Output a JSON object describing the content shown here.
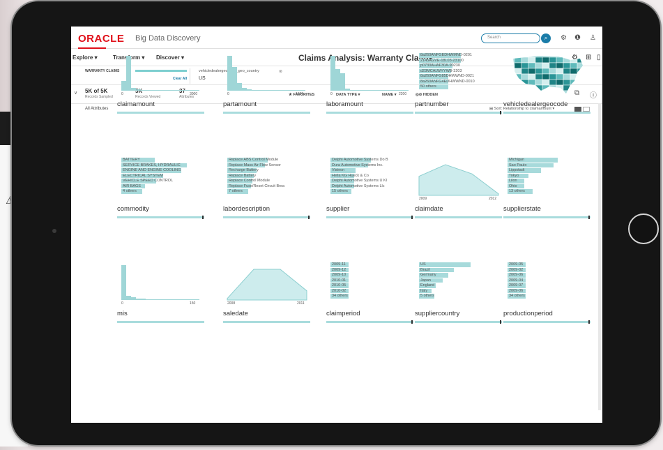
{
  "header": {
    "logo": "ORACLE",
    "product": "Big Data Discovery",
    "search_placeholder": "Search"
  },
  "nav": {
    "items": [
      "Explore ▾",
      "Transform ▾",
      "Discover ▾"
    ],
    "page_title": "Claims Analysis: Warranty Claims"
  },
  "refine": {
    "dataset": "WARRANTY CLAIMS",
    "clear_all": "Clear All",
    "facet_name": "vehicledealergeocode_geo_country",
    "facet_close": "⊗",
    "facet_value": "US"
  },
  "stats": {
    "sampled_value": "5K of 5K",
    "sampled_label": "Records Sampled",
    "viewed_value": "5K",
    "viewed_label": "Records Viewed",
    "attrs_value": "37",
    "attrs_label": "Attributes"
  },
  "toolbar": {
    "favorites": "★ FAVORITES",
    "data_type": "DATA TYPE ▾",
    "name": "NAME ▾",
    "hidden": "◎⊘ HIDDEN"
  },
  "sub": {
    "all_attributes": "All Attributes",
    "sort": "▤ Sort: Relationship to claimamount ▾"
  },
  "colors": {
    "bar": "#9fd6d7",
    "accent": "#1a7ca8",
    "brand": "#e0101a"
  },
  "tiles": [
    {
      "name": "claimamount",
      "type": "histogram",
      "bars": [
        0.28,
        1.0,
        0.08,
        0.04,
        0.02,
        0.02,
        0.02,
        0.01,
        0.01,
        0.01,
        0.01,
        0.01,
        0.01,
        0.01,
        0.01,
        0.01
      ],
      "xmin": "0",
      "xmax": "3000"
    },
    {
      "name": "partamount",
      "type": "histogram",
      "bars": [
        1.0,
        0.68,
        0.22,
        0.08,
        0.05,
        0.03,
        0.02,
        0.02,
        0.02,
        0.01,
        0.01,
        0.01,
        0.01,
        0.01,
        0.01,
        0.01
      ],
      "xmin": "0",
      "xmax": "1600"
    },
    {
      "name": "laboramount",
      "type": "histogram",
      "bars": [
        1.0,
        0.62,
        0.5,
        0.07,
        0.03,
        0.02,
        0.02,
        0.01,
        0.01,
        0.01,
        0.01,
        0.01,
        0.01,
        0.01,
        0.01,
        0.01
      ],
      "xmin": "0",
      "xmax": "2200"
    },
    {
      "name": "partnumber",
      "type": "list",
      "items": [
        {
          "label": "8a260ANFGEDHWMND-0201",
          "value": 0.5
        },
        {
          "label": "2145AGVE-18L03-23100",
          "value": 0.5
        },
        {
          "label": "p0730AHAF30A-90230",
          "value": 0.4
        },
        {
          "label": "d23MCALWYYWB-3203",
          "value": 0.38
        },
        {
          "label": "8a260ANFG85DHWWND-0021",
          "value": 0.35
        },
        {
          "label": "8a260ANFG4EDHWWND-0010",
          "value": 0.35
        },
        {
          "label": "50 others",
          "value": 0.35
        }
      ]
    },
    {
      "name": "vehicledealergeocode",
      "type": "map"
    },
    {
      "name": "commodity",
      "type": "list",
      "items": [
        {
          "label": "BATTERY",
          "value": 0.4
        },
        {
          "label": "SERVICE BRAKES, HYDRAULIC",
          "value": 0.78
        },
        {
          "label": "ENGINE AND ENGINE COOLING",
          "value": 0.72
        },
        {
          "label": "ELECTRICAL SYSTEM",
          "value": 0.5
        },
        {
          "label": "VEHICLE SPEED CONTROL",
          "value": 0.42
        },
        {
          "label": "AIR BAGS",
          "value": 0.28
        },
        {
          "label": "4 others",
          "value": 0.25
        }
      ]
    },
    {
      "name": "labordescription",
      "type": "list",
      "items": [
        {
          "label": "Replace ABS Control Module",
          "value": 0.48
        },
        {
          "label": "Replace Mass Air Flow Sensor",
          "value": 0.45
        },
        {
          "label": "Recharge Battery",
          "value": 0.35
        },
        {
          "label": "Replace Battery",
          "value": 0.32
        },
        {
          "label": "Replace Control Module",
          "value": 0.3
        },
        {
          "label": "Replace Fuse/Reset Circuit Brea",
          "value": 0.28
        },
        {
          "label": "7 others",
          "value": 0.25
        }
      ]
    },
    {
      "name": "supplier",
      "type": "list",
      "items": [
        {
          "label": "Delphi Automotive Systems Do B",
          "value": 0.48
        },
        {
          "label": "Dura Automotive Systems Inc.",
          "value": 0.45
        },
        {
          "label": "Visteon",
          "value": 0.3
        },
        {
          "label": "Hella KG Hueck & Co",
          "value": 0.28
        },
        {
          "label": "Delphi Automotive Systems U Kl",
          "value": 0.28
        },
        {
          "label": "Delphi Automotive Systems Llc",
          "value": 0.28
        },
        {
          "label": "15 others",
          "value": 0.25
        }
      ]
    },
    {
      "name": "claimdate",
      "type": "area",
      "points": [
        0.62,
        1.0,
        0.7,
        0.05
      ],
      "xmin": "2009",
      "xmax": "2012"
    },
    {
      "name": "supplierstate",
      "type": "list",
      "items": [
        {
          "label": "Michigan",
          "value": 0.6
        },
        {
          "label": "Sao Paulo",
          "value": 0.55
        },
        {
          "label": "Lippstadt",
          "value": 0.4
        },
        {
          "label": "Tokyo",
          "value": 0.25
        },
        {
          "label": "Lilon",
          "value": 0.2
        },
        {
          "label": "Ohio",
          "value": 0.2
        },
        {
          "label": "13 others",
          "value": 0.3
        }
      ]
    },
    {
      "name": "mis",
      "type": "histogram",
      "bars": [
        1.0,
        0.12,
        0.08,
        0.05,
        0.04,
        0.03,
        0.03,
        0.02,
        0.02,
        0.02,
        0.02,
        0.02,
        0.02,
        0.02,
        0.02,
        0.02
      ],
      "xmin": "0",
      "xmax": "150"
    },
    {
      "name": "saledate",
      "type": "area",
      "points": [
        0.05,
        1.0,
        1.0,
        0.3
      ],
      "xmin": "2008",
      "xmax": "2011"
    },
    {
      "name": "claimperiod",
      "type": "list",
      "items": [
        {
          "label": "2009-11",
          "value": 0.22
        },
        {
          "label": "2009-12",
          "value": 0.22
        },
        {
          "label": "2009-10",
          "value": 0.22
        },
        {
          "label": "2010-01",
          "value": 0.22
        },
        {
          "label": "2010-05",
          "value": 0.22
        },
        {
          "label": "2010-02",
          "value": 0.22
        },
        {
          "label": "34 others",
          "value": 0.22
        }
      ]
    },
    {
      "name": "suppliercountry",
      "type": "list",
      "items": [
        {
          "label": "US",
          "value": 0.62
        },
        {
          "label": "Brazil",
          "value": 0.42
        },
        {
          "label": "Germany",
          "value": 0.35
        },
        {
          "label": "Japan",
          "value": 0.28
        },
        {
          "label": "England",
          "value": 0.2
        },
        {
          "label": "Italy",
          "value": 0.15
        },
        {
          "label": "5 others",
          "value": 0.18
        }
      ]
    },
    {
      "name": "productionperiod",
      "type": "list",
      "items": [
        {
          "label": "2009-05",
          "value": 0.22
        },
        {
          "label": "2009-02",
          "value": 0.22
        },
        {
          "label": "2009-06",
          "value": 0.22
        },
        {
          "label": "2009-04",
          "value": 0.22
        },
        {
          "label": "2009-07",
          "value": 0.22
        },
        {
          "label": "2009-06",
          "value": 0.22
        },
        {
          "label": "34 others",
          "value": 0.22
        }
      ]
    }
  ]
}
